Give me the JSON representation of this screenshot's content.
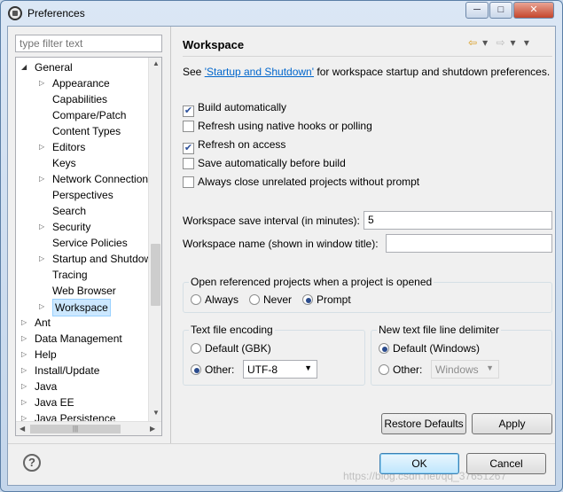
{
  "window": {
    "title": "Preferences",
    "min": "─",
    "max": "□",
    "close": "✕"
  },
  "filter": {
    "placeholder": "type filter text"
  },
  "tree": [
    {
      "label": "General",
      "indent": 1,
      "arrow": "open"
    },
    {
      "label": "Appearance",
      "indent": 2,
      "arrow": "closed"
    },
    {
      "label": "Capabilities",
      "indent": 2,
      "arrow": ""
    },
    {
      "label": "Compare/Patch",
      "indent": 2,
      "arrow": ""
    },
    {
      "label": "Content Types",
      "indent": 2,
      "arrow": ""
    },
    {
      "label": "Editors",
      "indent": 2,
      "arrow": "closed"
    },
    {
      "label": "Keys",
      "indent": 2,
      "arrow": ""
    },
    {
      "label": "Network Connection",
      "indent": 2,
      "arrow": "closed"
    },
    {
      "label": "Perspectives",
      "indent": 2,
      "arrow": ""
    },
    {
      "label": "Search",
      "indent": 2,
      "arrow": ""
    },
    {
      "label": "Security",
      "indent": 2,
      "arrow": "closed"
    },
    {
      "label": "Service Policies",
      "indent": 2,
      "arrow": ""
    },
    {
      "label": "Startup and Shutdown",
      "indent": 2,
      "arrow": "closed"
    },
    {
      "label": "Tracing",
      "indent": 2,
      "arrow": ""
    },
    {
      "label": "Web Browser",
      "indent": 2,
      "arrow": ""
    },
    {
      "label": "Workspace",
      "indent": 2,
      "arrow": "closed",
      "selected": true
    },
    {
      "label": "Ant",
      "indent": 1,
      "arrow": "closed"
    },
    {
      "label": "Data Management",
      "indent": 1,
      "arrow": "closed"
    },
    {
      "label": "Help",
      "indent": 1,
      "arrow": "closed"
    },
    {
      "label": "Install/Update",
      "indent": 1,
      "arrow": "closed"
    },
    {
      "label": "Java",
      "indent": 1,
      "arrow": "closed"
    },
    {
      "label": "Java EE",
      "indent": 1,
      "arrow": "closed"
    },
    {
      "label": "Java Persistence",
      "indent": 1,
      "arrow": "closed"
    }
  ],
  "page": {
    "title": "Workspace",
    "desc_prefix": "See ",
    "desc_link": "'Startup and Shutdown'",
    "desc_suffix": " for workspace startup and shutdown preferences.",
    "checkboxes": [
      {
        "label": "Build automatically",
        "checked": true
      },
      {
        "label": "Refresh using native hooks or polling",
        "checked": false
      },
      {
        "label": "Refresh on access",
        "checked": true
      },
      {
        "label": "Save automatically before build",
        "checked": false
      },
      {
        "label": "Always close unrelated projects without prompt",
        "checked": false
      }
    ],
    "save_interval_label": "Workspace save interval (in minutes):",
    "save_interval_value": "5",
    "ws_name_label": "Workspace name (shown in window title):",
    "ws_name_value": "",
    "open_ref": {
      "title": "Open referenced projects when a project is opened",
      "always": "Always",
      "never": "Never",
      "prompt": "Prompt",
      "selected": "Prompt"
    },
    "encoding": {
      "title": "Text file encoding",
      "default": "Default (GBK)",
      "other": "Other:",
      "other_value": "UTF-8",
      "selected": "Other"
    },
    "delimiter": {
      "title": "New text file line delimiter",
      "default": "Default (Windows)",
      "other": "Other:",
      "other_value": "Windows",
      "selected": "Default"
    },
    "restore_label": "Restore Defaults",
    "apply_label": "Apply"
  },
  "footer": {
    "help": "?",
    "ok_label": "OK",
    "cancel_label": "Cancel"
  },
  "watermark": "https://blog.csdn.net/qq_37651267",
  "icons": {
    "nav_back": "⇦",
    "nav_fwd": "⇨",
    "dropdown": "▾",
    "menu": "▾"
  },
  "colors": {
    "link": "#0066cc",
    "selection": "#cce8ff"
  }
}
